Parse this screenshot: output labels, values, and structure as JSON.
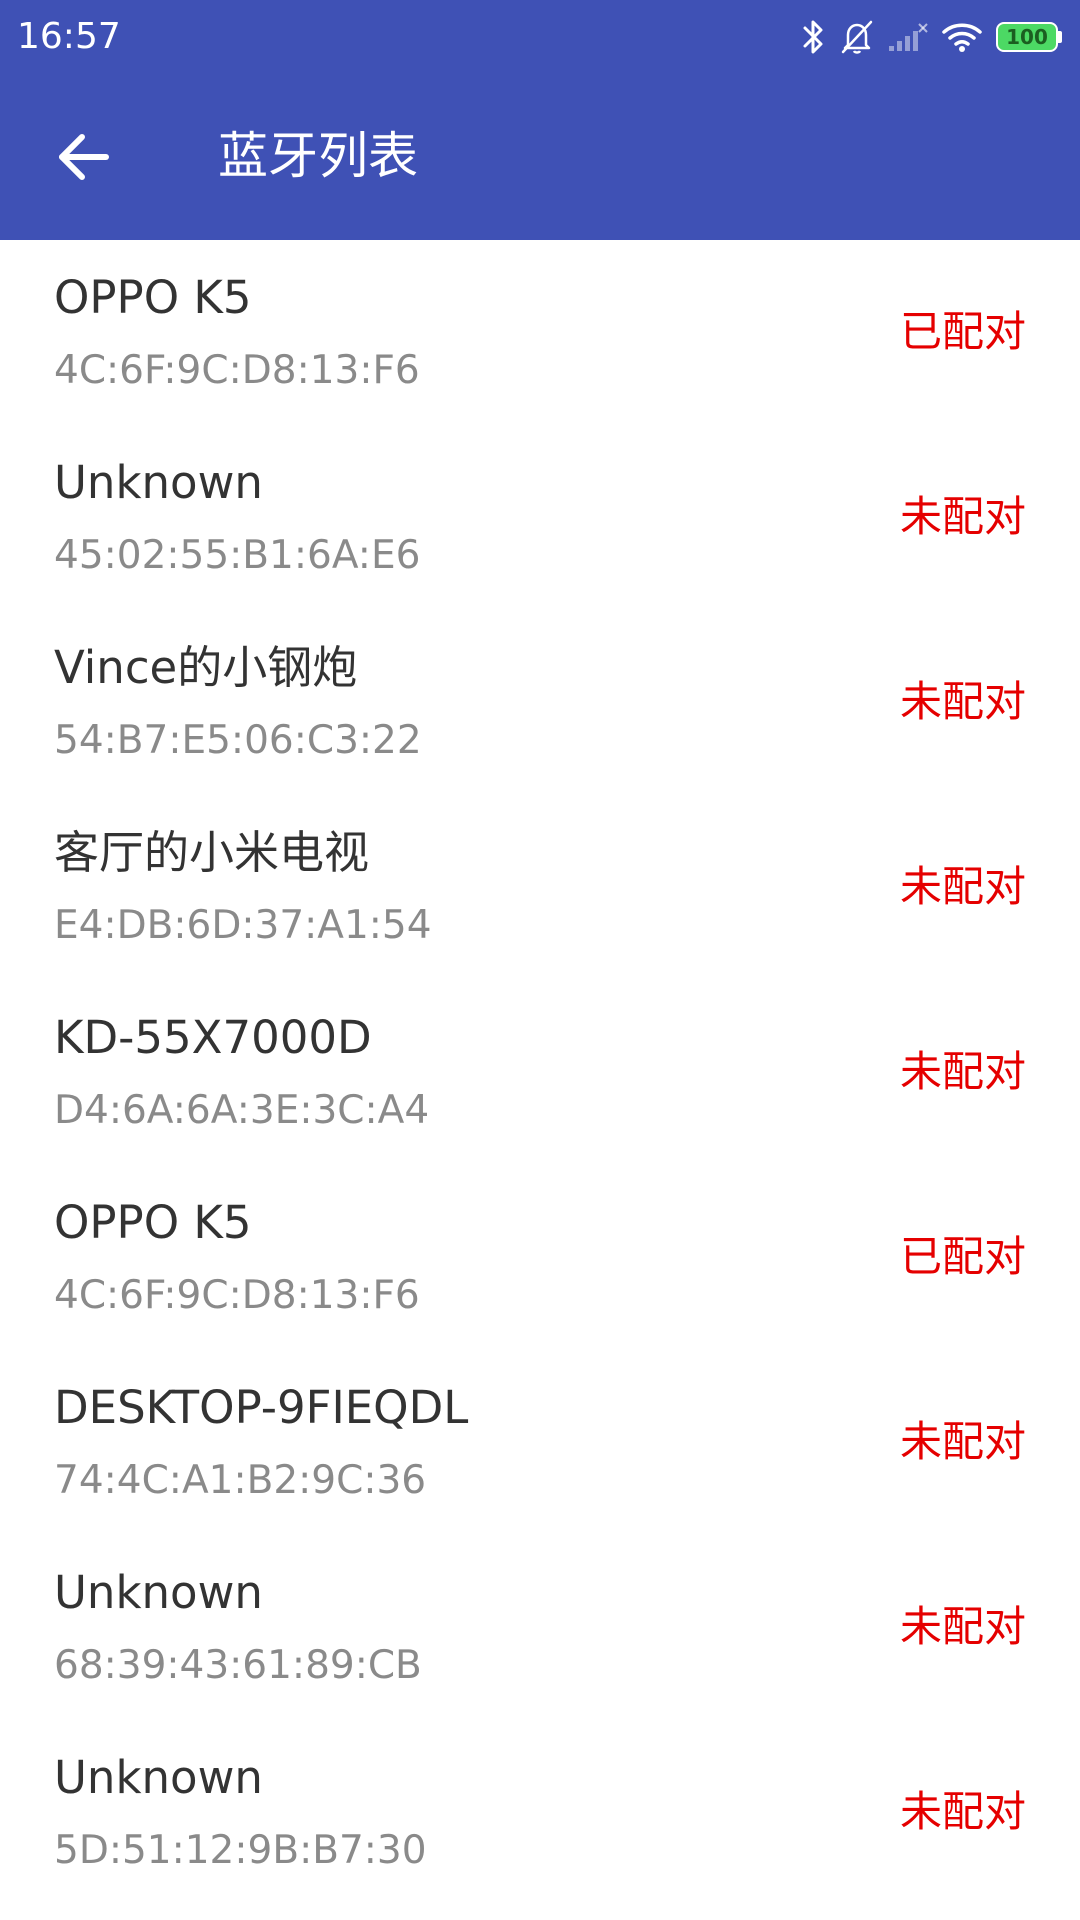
{
  "status_bar": {
    "time": "16:57",
    "icons": [
      "bluetooth-icon",
      "bell-muted-icon",
      "cell-signal-icon",
      "wifi-icon",
      "battery-icon"
    ],
    "battery_level": "100",
    "battery_color": "#4CD964"
  },
  "app_bar": {
    "title": "蓝牙列表",
    "back_icon": "arrow-back-icon",
    "color": "#3F51B5"
  },
  "colors": {
    "status_text": "#E50000",
    "name_text": "#333333",
    "mac_text": "#8A8A8A"
  },
  "devices": [
    {
      "name": "OPPO K5",
      "mac": "4C:6F:9C:D8:13:F6",
      "status": "已配对"
    },
    {
      "name": "Unknown",
      "mac": "45:02:55:B1:6A:E6",
      "status": "未配对"
    },
    {
      "name": "Vince的小钢炮",
      "mac": "54:B7:E5:06:C3:22",
      "status": "未配对"
    },
    {
      "name": "客厅的小米电视",
      "mac": "E4:DB:6D:37:A1:54",
      "status": "未配对"
    },
    {
      "name": "KD-55X7000D",
      "mac": "D4:6A:6A:3E:3C:A4",
      "status": "未配对"
    },
    {
      "name": "OPPO K5",
      "mac": "4C:6F:9C:D8:13:F6",
      "status": "已配对"
    },
    {
      "name": "DESKTOP-9FIEQDL",
      "mac": "74:4C:A1:B2:9C:36",
      "status": "未配对"
    },
    {
      "name": "Unknown",
      "mac": "68:39:43:61:89:CB",
      "status": "未配对"
    },
    {
      "name": "Unknown",
      "mac": "5D:51:12:9B:B7:30",
      "status": "未配对"
    }
  ]
}
